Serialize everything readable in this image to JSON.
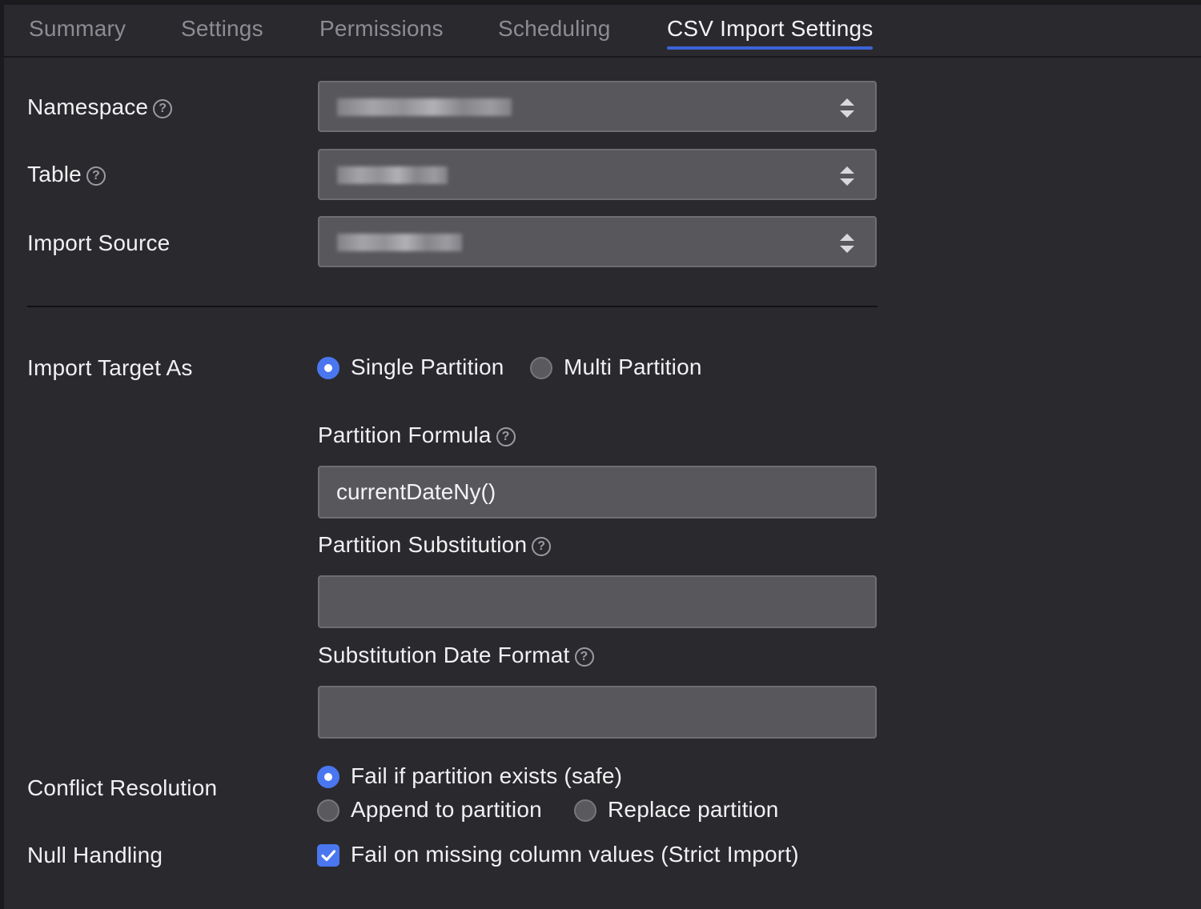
{
  "tabs": [
    {
      "label": "Summary",
      "active": false
    },
    {
      "label": "Settings",
      "active": false
    },
    {
      "label": "Permissions",
      "active": false
    },
    {
      "label": "Scheduling",
      "active": false
    },
    {
      "label": "CSV Import Settings",
      "active": true
    }
  ],
  "fields": {
    "namespace": {
      "label": "Namespace",
      "value_redacted": true
    },
    "table": {
      "label": "Table",
      "value_redacted": true
    },
    "import_source": {
      "label": "Import Source",
      "value_redacted": true
    }
  },
  "import_target": {
    "label": "Import Target As",
    "options": [
      {
        "label": "Single Partition",
        "selected": true
      },
      {
        "label": "Multi Partition",
        "selected": false
      }
    ]
  },
  "partition_formula": {
    "label": "Partition Formula",
    "value": "currentDateNy()"
  },
  "partition_substitution": {
    "label": "Partition Substitution",
    "value": ""
  },
  "substitution_date_format": {
    "label": "Substitution Date Format",
    "value": ""
  },
  "conflict_resolution": {
    "label": "Conflict Resolution",
    "options": [
      {
        "label": "Fail if partition exists (safe)",
        "selected": true
      },
      {
        "label": "Append to partition",
        "selected": false
      },
      {
        "label": "Replace partition",
        "selected": false
      }
    ]
  },
  "null_handling": {
    "label": "Null Handling",
    "checkbox": {
      "label": "Fail on missing column values (Strict Import)",
      "checked": true
    }
  },
  "icons": {
    "help": "help-circle-icon",
    "select": "sort-arrows-icon",
    "check": "checkmark-icon"
  },
  "colors": {
    "background": "#2a292e",
    "accent": "#4a77f0",
    "field": "#58575c",
    "tab_underline": "#3d63d8"
  }
}
